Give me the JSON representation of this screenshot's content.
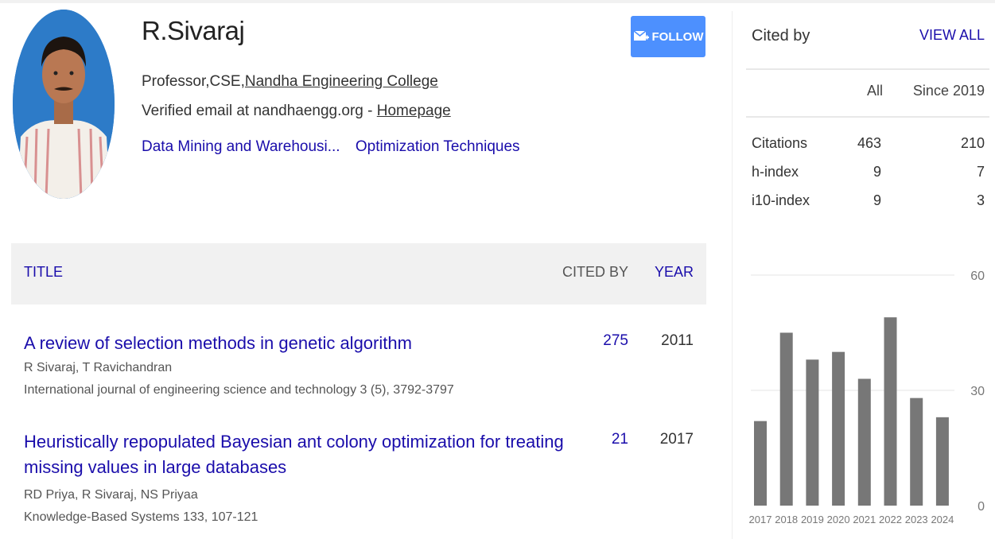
{
  "profile": {
    "name": "R.Sivaraj",
    "affiliation_prefix": "Professor,CSE,",
    "affiliation_org": "Nandha Engineering College",
    "email_text": "Verified email at nandhaengg.org - ",
    "homepage_label": "Homepage",
    "interests": [
      "Data Mining and Warehousi...",
      "Optimization Techniques"
    ],
    "follow_label": "FOLLOW"
  },
  "table": {
    "headers": {
      "title": "TITLE",
      "cited_by": "CITED BY",
      "year": "YEAR"
    },
    "rows": [
      {
        "title": "A review of selection methods in genetic algorithm",
        "authors": "R Sivaraj, T Ravichandran",
        "venue": "International journal of engineering science and technology 3 (5), 3792-3797",
        "cited_by": "275",
        "year": "2011"
      },
      {
        "title": "Heuristically repopulated Bayesian ant colony optimization for treating missing values in large databases",
        "authors": "RD Priya, R Sivaraj, NS Priyaa",
        "venue": "Knowledge-Based Systems 133, 107-121",
        "cited_by": "21",
        "year": "2017"
      }
    ]
  },
  "cited_by": {
    "title": "Cited by",
    "view_all": "VIEW ALL",
    "col_all": "All",
    "col_since": "Since 2019",
    "metrics": [
      {
        "label": "Citations",
        "all": "463",
        "since": "210"
      },
      {
        "label": "h-index",
        "all": "9",
        "since": "7"
      },
      {
        "label": "i10-index",
        "all": "9",
        "since": "3"
      }
    ]
  },
  "colors": {
    "link": "#1a0dab",
    "follow_button": "#4d90fe",
    "bar": "#777777"
  },
  "chart_data": {
    "type": "bar",
    "categories": [
      "2017",
      "2018",
      "2019",
      "2020",
      "2021",
      "2022",
      "2023",
      "2024"
    ],
    "values": [
      22,
      45,
      38,
      40,
      33,
      49,
      28,
      23
    ],
    "yticks": [
      "0",
      "30",
      "60"
    ],
    "ylim": [
      0,
      60
    ]
  }
}
